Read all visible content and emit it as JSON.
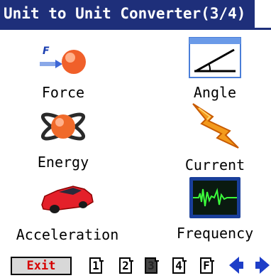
{
  "title": "Unit to Unit Converter(3/4)",
  "items": [
    {
      "label": "Force"
    },
    {
      "label": "Angle"
    },
    {
      "label": "Energy"
    },
    {
      "label": "Current"
    },
    {
      "label": "Acceleration"
    },
    {
      "label": "Frequency"
    }
  ],
  "bottom": {
    "exit_label": "Exit",
    "pages": [
      "1",
      "2",
      "3",
      "4",
      "F"
    ],
    "active_page": "3"
  },
  "icons": {
    "force_letter": "F"
  },
  "colors": {
    "title_bg": "#1e2f7a",
    "exit_text": "#d60000",
    "arrow": "#1e3ec8"
  }
}
